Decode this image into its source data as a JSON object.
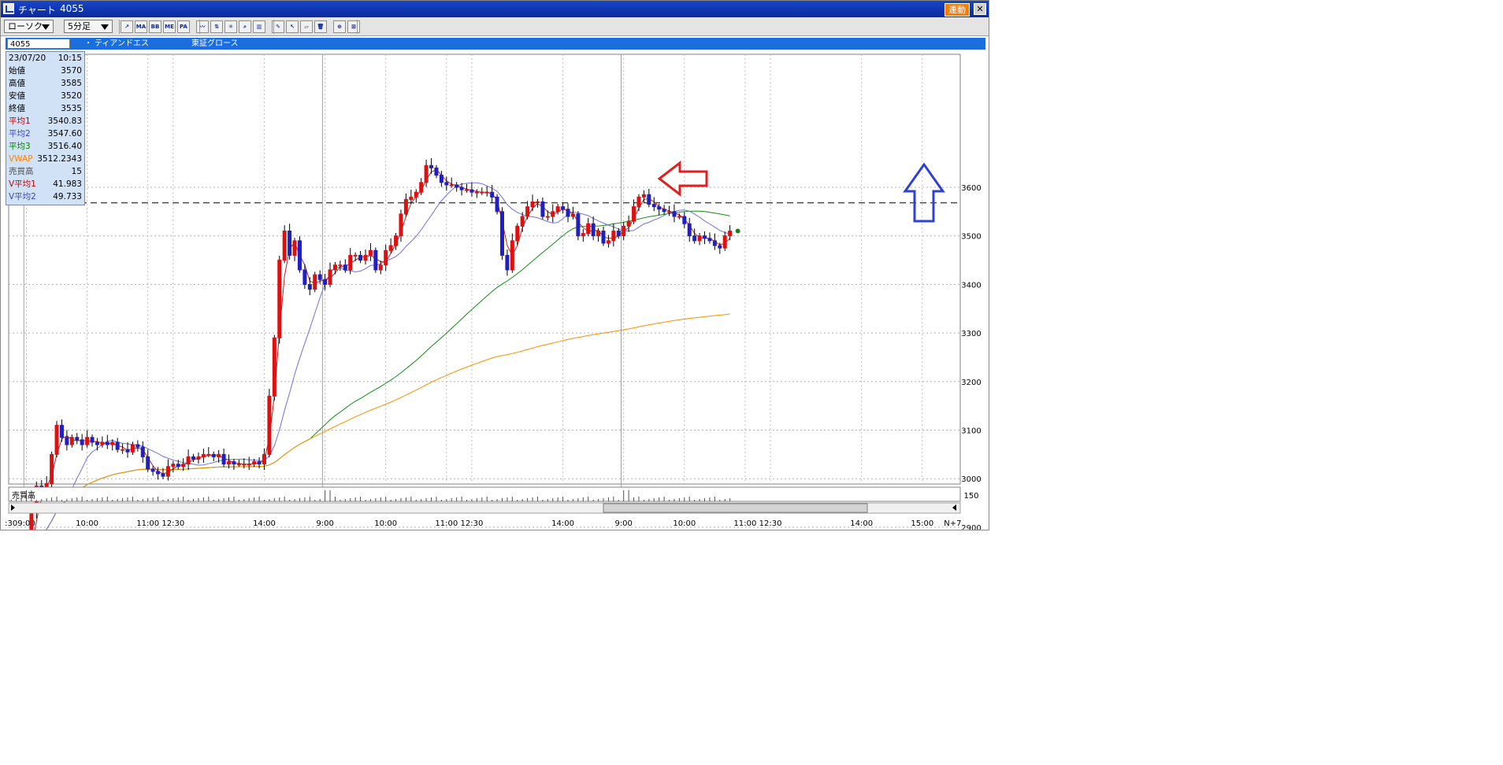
{
  "window": {
    "title": "チャート",
    "code": "4055",
    "link_label": "連動",
    "close_label": "✕"
  },
  "toolbar": {
    "chart_type": "ローソク",
    "interval": "5分足",
    "tools": [
      "indicator-icon",
      "ma-icon",
      "bb-icon",
      "me-icon",
      "pa-icon",
      "line-chart-icon",
      "compare-icon",
      "star-icon",
      "zoom-icon",
      "period-icon",
      "pencil-icon",
      "pointer-icon",
      "eraser-icon",
      "delete-icon",
      "find-icon",
      "clear-icon"
    ]
  },
  "infobar": {
    "code": "4055",
    "name": "ティアンドエス",
    "market": "東証グロース"
  },
  "panel": {
    "date": "23/07/20",
    "time": "10:15",
    "rows": [
      {
        "label": "始値",
        "value": "3570",
        "color": "#000000"
      },
      {
        "label": "高値",
        "value": "3585",
        "color": "#000000"
      },
      {
        "label": "安値",
        "value": "3520",
        "color": "#000000"
      },
      {
        "label": "終値",
        "value": "3535",
        "color": "#000000"
      },
      {
        "label": "平均1",
        "value": "3540.83",
        "color": "#c00000"
      },
      {
        "label": "平均2",
        "value": "3547.60",
        "color": "#4040c0"
      },
      {
        "label": "平均3",
        "value": "3516.40",
        "color": "#008000"
      },
      {
        "label": "VWAP",
        "value": "3512.2343",
        "color": "#ff8000"
      },
      {
        "label": "売買高",
        "value": "15",
        "color": "#505050"
      },
      {
        "label": "V平均1",
        "value": "41.983",
        "color": "#c00000"
      },
      {
        "label": "V平均2",
        "value": "49.733",
        "color": "#4040c0"
      }
    ]
  },
  "colors": {
    "up": "#dd1111",
    "down": "#2020c0",
    "ma1": "#c02020",
    "ma2": "#7070e0",
    "ma3": "#109010",
    "vwap": "#ff8c00",
    "arrow_red": "#e02020",
    "arrow_blue": "#3040d0"
  },
  "chart_data": {
    "type": "candlestick",
    "ylim": [
      2860,
      3680
    ],
    "yticks": [
      "3600",
      "3500",
      "3400",
      "3300",
      "3200",
      "3100",
      "3000",
      "2900"
    ],
    "reference_line": 3568,
    "volume_label": "売買高",
    "volume_tick": "150",
    "xticks": [
      {
        "i": 0,
        "label": ":30"
      },
      {
        "i": 3,
        "label": "9:00"
      },
      {
        "i": 15,
        "label": "10:00"
      },
      {
        "i": 27,
        "label": "11:00"
      },
      {
        "i": 32,
        "label": "12:30"
      },
      {
        "i": 50,
        "label": "14:00"
      },
      {
        "i": 62,
        "label": "9:00"
      },
      {
        "i": 74,
        "label": "10:00"
      },
      {
        "i": 86,
        "label": "11:00"
      },
      {
        "i": 91,
        "label": "12:30"
      },
      {
        "i": 109,
        "label": "14:00"
      },
      {
        "i": 121,
        "label": "9:00"
      },
      {
        "i": 133,
        "label": "10:00"
      },
      {
        "i": 145,
        "label": "11:00"
      },
      {
        "i": 150,
        "label": "12:30"
      },
      {
        "i": 168,
        "label": "14:00"
      },
      {
        "i": 180,
        "label": "15:00"
      },
      {
        "i": 186,
        "label": "N+7"
      }
    ],
    "day_separators": [
      3,
      62,
      121
    ],
    "closes": [
      2822,
      2820,
      2822,
      2823,
      2930,
      2985,
      2975,
      2990,
      3050,
      3110,
      3085,
      3070,
      3085,
      3080,
      3070,
      3085,
      3075,
      3070,
      3075,
      3070,
      3075,
      3060,
      3060,
      3055,
      3070,
      3065,
      3045,
      3020,
      3015,
      3010,
      3005,
      3025,
      3030,
      3025,
      3030,
      3045,
      3040,
      3045,
      3050,
      3050,
      3045,
      3050,
      3030,
      3035,
      3030,
      3030,
      3030,
      3030,
      3035,
      3030,
      3050,
      3170,
      3290,
      3450,
      3510,
      3460,
      3490,
      3430,
      3400,
      3390,
      3420,
      3410,
      3400,
      3430,
      3440,
      3440,
      3430,
      3460,
      3460,
      3450,
      3460,
      3470,
      3430,
      3440,
      3470,
      3480,
      3500,
      3545,
      3575,
      3580,
      3590,
      3610,
      3645,
      3640,
      3625,
      3610,
      3605,
      3605,
      3600,
      3595,
      3595,
      3590,
      3590,
      3590,
      3590,
      3580,
      3550,
      3460,
      3430,
      3490,
      3520,
      3540,
      3560,
      3570,
      3570,
      3540,
      3540,
      3550,
      3560,
      3555,
      3540,
      3545,
      3500,
      3505,
      3525,
      3500,
      3510,
      3485,
      3490,
      3510,
      3500,
      3520,
      3530,
      3560,
      3580,
      3585,
      3565,
      3560,
      3555,
      3550,
      3550,
      3540,
      3540,
      3525,
      3500,
      3490,
      3500,
      3495,
      3490,
      3480,
      3475,
      3500,
      3510
    ],
    "min_len_note": ""
  }
}
